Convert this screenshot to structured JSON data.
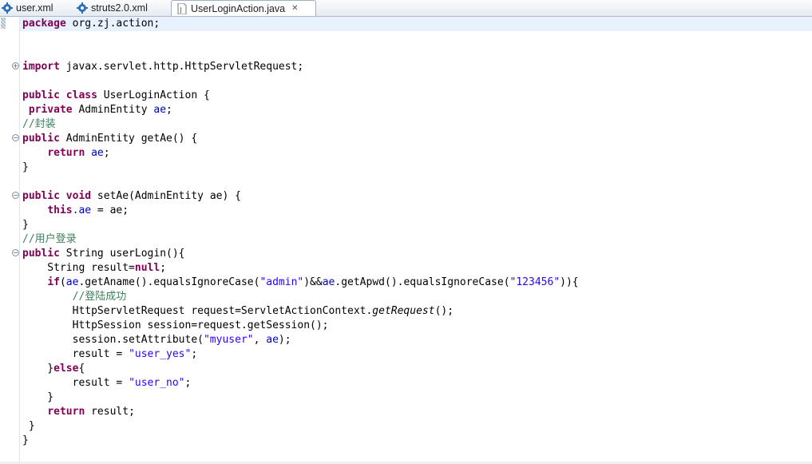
{
  "tabs": [
    {
      "label": "user.xml",
      "icon": "xml-gear-icon"
    },
    {
      "label": "struts2.0.xml",
      "icon": "xml-gear-icon"
    },
    {
      "label": "UserLoginAction.java",
      "icon": "java-file-icon",
      "active": true
    }
  ],
  "code": {
    "l01": [
      "package",
      " org.zj.action;"
    ],
    "l04": [
      "import",
      " javax.servlet.http.HttpServletRequest;"
    ],
    "l06": [
      "public",
      " ",
      "class",
      " UserLoginAction {"
    ],
    "l07": [
      " ",
      "private",
      " AdminEntity ",
      "ae",
      ";"
    ],
    "l08": [
      "//封装"
    ],
    "l09": [
      "public",
      " AdminEntity getAe() {"
    ],
    "l10": [
      "    ",
      "return",
      " ",
      "ae",
      ";"
    ],
    "l11": [
      "}"
    ],
    "l13": [
      "public",
      " ",
      "void",
      " setAe(AdminEntity ae) {"
    ],
    "l14": [
      "    ",
      "this",
      ".",
      "ae",
      " = ae;"
    ],
    "l15": [
      "}"
    ],
    "l16": [
      "//用户登录"
    ],
    "l17": [
      "public",
      " String userLogin(){"
    ],
    "l18": [
      "    String result=",
      "null",
      ";"
    ],
    "l19": [
      "    ",
      "if",
      "(",
      "ae",
      ".getAname().equalsIgnoreCase(",
      "\"admin\"",
      ")&&",
      "ae",
      ".getApwd().equalsIgnoreCase(",
      "\"123456\"",
      ")){"
    ],
    "l20": [
      "        ",
      "//登陆成功"
    ],
    "l21": [
      "        HttpServletRequest request=ServletActionContext.",
      "getRequest",
      "();"
    ],
    "l22": [
      "        HttpSession session=request.getSession();"
    ],
    "l23": [
      "        session.setAttribute(",
      "\"myuser\"",
      ", ",
      "ae",
      ");"
    ],
    "l24": [
      "        result = ",
      "\"user_yes\"",
      ";"
    ],
    "l25": [
      "    }",
      "else",
      "{"
    ],
    "l26": [
      "        result = ",
      "\"user_no\"",
      ";"
    ],
    "l27": [
      "    }"
    ],
    "l28": [
      "    ",
      "return",
      " result;"
    ],
    "l29": [
      " }"
    ],
    "l30": [
      "}"
    ]
  }
}
